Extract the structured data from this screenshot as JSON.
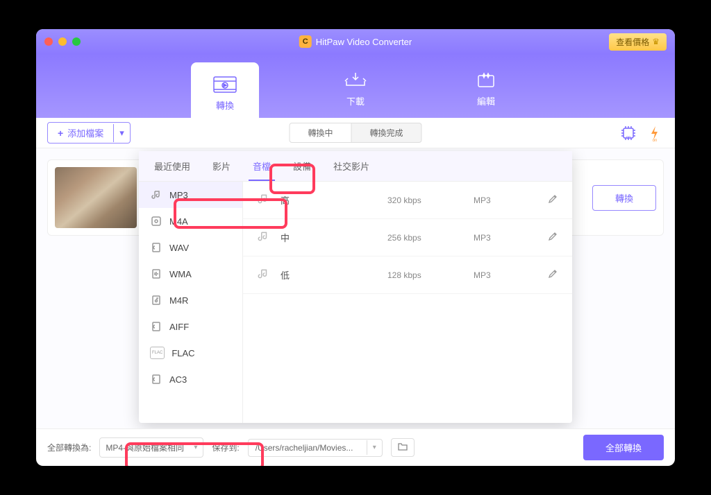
{
  "app": {
    "title": "HitPaw Video Converter",
    "price_button": "查看價格"
  },
  "main_tabs": {
    "convert": "轉換",
    "download": "下載",
    "edit": "編輯"
  },
  "toolbar": {
    "add_file": "添加檔案",
    "converting": "轉換中",
    "converted": "轉換完成"
  },
  "card": {
    "convert_btn": "轉換"
  },
  "popup": {
    "tabs": {
      "recent": "最近使用",
      "video": "影片",
      "audio": "音檔",
      "device": "設備",
      "social": "社交影片"
    },
    "formats": [
      "MP3",
      "M4A",
      "WAV",
      "WMA",
      "M4R",
      "AIFF",
      "FLAC",
      "AC3"
    ],
    "qualities": [
      {
        "name": "高",
        "bitrate": "320 kbps",
        "fmt": "MP3"
      },
      {
        "name": "中",
        "bitrate": "256 kbps",
        "fmt": "MP3"
      },
      {
        "name": "低",
        "bitrate": "128 kbps",
        "fmt": "MP3"
      }
    ]
  },
  "bottom": {
    "convert_all_label": "全部轉換為:",
    "convert_all_value": "MP4-與原始檔案相同",
    "save_to_label": "保存到:",
    "save_to_path": "/Users/racheljian/Movies...",
    "convert_all_btn": "全部轉換"
  }
}
